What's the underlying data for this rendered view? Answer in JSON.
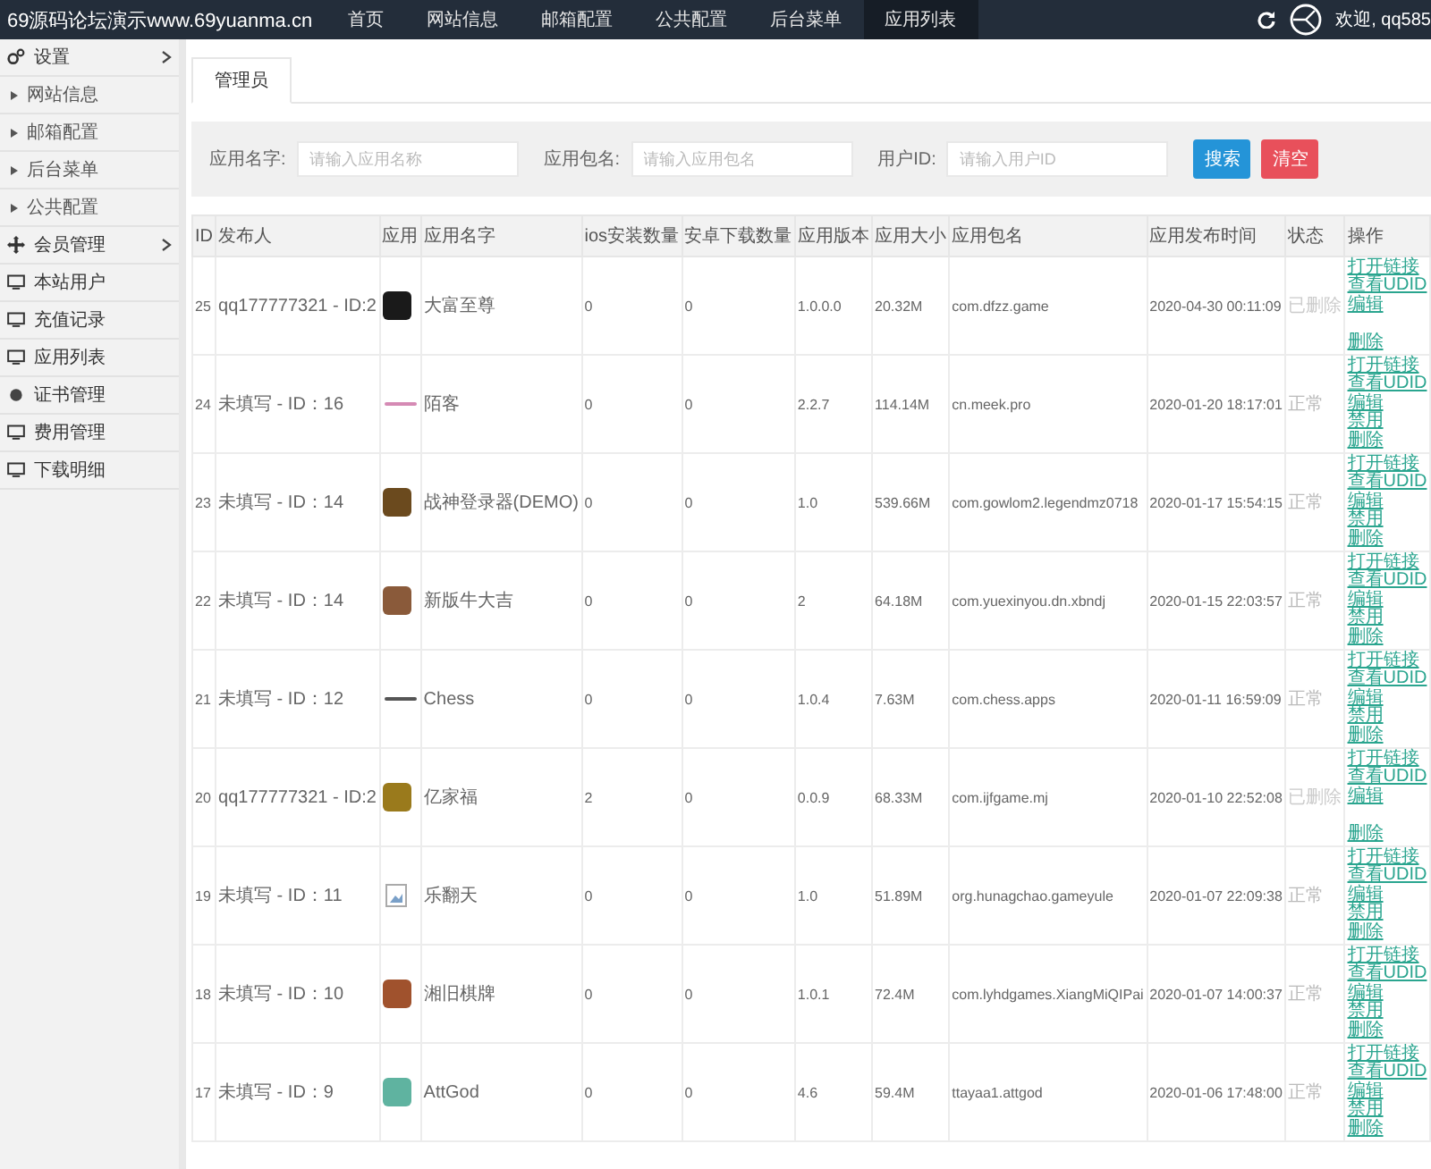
{
  "header": {
    "site_title": "69源码论坛演示www.69yuanma.cn",
    "nav": [
      {
        "label": "首页",
        "selected": false
      },
      {
        "label": "网站信息",
        "selected": false
      },
      {
        "label": "邮箱配置",
        "selected": false
      },
      {
        "label": "公共配置",
        "selected": false
      },
      {
        "label": "后台菜单",
        "selected": false
      },
      {
        "label": "应用列表",
        "selected": true
      }
    ],
    "welcome": "欢迎, qq585"
  },
  "sidebar": {
    "items": [
      {
        "label": "设置",
        "kind": "settings",
        "children": [
          {
            "label": "网站信息"
          },
          {
            "label": "邮箱配置"
          },
          {
            "label": "后台菜单"
          },
          {
            "label": "公共配置"
          }
        ]
      },
      {
        "label": "会员管理",
        "kind": "members"
      },
      {
        "label": "本站用户",
        "kind": "page"
      },
      {
        "label": "充值记录",
        "kind": "page"
      },
      {
        "label": "应用列表",
        "kind": "page"
      },
      {
        "label": "证书管理",
        "kind": "certificate"
      },
      {
        "label": "费用管理",
        "kind": "page"
      },
      {
        "label": "下载明细",
        "kind": "page"
      }
    ]
  },
  "tabs": [
    {
      "label": "管理员",
      "selected": true
    }
  ],
  "filters": {
    "fields": [
      {
        "label": "应用名字:",
        "placeholder": "请输入应用名称"
      },
      {
        "label": "应用包名:",
        "placeholder": "请输入应用包名"
      },
      {
        "label": "用户ID:",
        "placeholder": "请输入用户ID"
      }
    ],
    "buttons": [
      {
        "label": "搜索",
        "kind": "primary"
      },
      {
        "label": "清空",
        "kind": "danger"
      }
    ]
  },
  "table": {
    "columns": [
      "ID",
      "发布人",
      "应用",
      "应用名字",
      "ios安装数量",
      "安卓下载数量",
      "应用版本",
      "应用大小",
      "应用包名",
      "应用发布时间",
      "状态",
      "操作"
    ],
    "rows": [
      {
        "id": "25",
        "publisher": "qq177777321 - ID:2",
        "icon": {
          "kind": "image",
          "color": "#1a1a1a"
        },
        "name": "大富至尊",
        "ios": "0",
        "android": "0",
        "version": "1.0.0.0",
        "size": "20.32M",
        "package": "com.dfzz.game",
        "time": "2020-04-30 00:11:09",
        "status": "已删除",
        "deleted": true,
        "actions": [
          "打开链接",
          "查看UDID",
          "编辑",
          "删除"
        ]
      },
      {
        "id": "24",
        "publisher": "未填写 - ID：16",
        "icon": {
          "kind": "wordmark",
          "color": "#d58ab4"
        },
        "name": "陌客",
        "ios": "0",
        "android": "0",
        "version": "2.2.7",
        "size": "114.14M",
        "package": "cn.meek.pro",
        "time": "2020-01-20 18:17:01",
        "status": "正常",
        "deleted": false,
        "actions": [
          "打开链接",
          "查看UDID",
          "编辑",
          "禁用",
          "删除"
        ]
      },
      {
        "id": "23",
        "publisher": "未填写 - ID：14",
        "icon": {
          "kind": "image",
          "color": "#6b4a1e"
        },
        "name": "战神登录器(DEMO)",
        "ios": "0",
        "android": "0",
        "version": "1.0",
        "size": "539.66M",
        "package": "com.gowlom2.legendmz0718",
        "time": "2020-01-17 15:54:15",
        "status": "正常",
        "deleted": false,
        "actions": [
          "打开链接",
          "查看UDID",
          "编辑",
          "禁用",
          "删除"
        ]
      },
      {
        "id": "22",
        "publisher": "未填写 - ID：14",
        "icon": {
          "kind": "image",
          "color": "#8a5a3a"
        },
        "name": "新版牛大吉",
        "ios": "0",
        "android": "0",
        "version": "2",
        "size": "64.18M",
        "package": "com.yuexinyou.dn.xbndj",
        "time": "2020-01-15 22:03:57",
        "status": "正常",
        "deleted": false,
        "actions": [
          "打开链接",
          "查看UDID",
          "编辑",
          "禁用",
          "删除"
        ]
      },
      {
        "id": "21",
        "publisher": "未填写 - ID：12",
        "icon": {
          "kind": "wordmark",
          "color": "#555555"
        },
        "name": "Chess",
        "ios": "0",
        "android": "0",
        "version": "1.0.4",
        "size": "7.63M",
        "package": "com.chess.apps",
        "time": "2020-01-11 16:59:09",
        "status": "正常",
        "deleted": false,
        "actions": [
          "打开链接",
          "查看UDID",
          "编辑",
          "禁用",
          "删除"
        ]
      },
      {
        "id": "20",
        "publisher": "qq177777321 - ID:2",
        "icon": {
          "kind": "image",
          "color": "#9a7a1c"
        },
        "name": "亿家福",
        "ios": "2",
        "android": "0",
        "version": "0.0.9",
        "size": "68.33M",
        "package": "com.ijfgame.mj",
        "time": "2020-01-10 22:52:08",
        "status": "已删除",
        "deleted": true,
        "actions": [
          "打开链接",
          "查看UDID",
          "编辑",
          "删除"
        ]
      },
      {
        "id": "19",
        "publisher": "未填写 - ID：11",
        "icon": {
          "kind": "broken",
          "color": "#7aa0c8"
        },
        "name": "乐翻天",
        "ios": "0",
        "android": "0",
        "version": "1.0",
        "size": "51.89M",
        "package": "org.hunagchao.gameyule",
        "time": "2020-01-07 22:09:38",
        "status": "正常",
        "deleted": false,
        "actions": [
          "打开链接",
          "查看UDID",
          "编辑",
          "禁用",
          "删除"
        ]
      },
      {
        "id": "18",
        "publisher": "未填写 - ID：10",
        "icon": {
          "kind": "image",
          "color": "#a0522d"
        },
        "name": "湘旧棋牌",
        "ios": "0",
        "android": "0",
        "version": "1.0.1",
        "size": "72.4M",
        "package": "com.lyhdgames.XiangMiQIPai",
        "time": "2020-01-07 14:00:37",
        "status": "正常",
        "deleted": false,
        "actions": [
          "打开链接",
          "查看UDID",
          "编辑",
          "禁用",
          "删除"
        ]
      },
      {
        "id": "17",
        "publisher": "未填写 - ID：9",
        "icon": {
          "kind": "image",
          "color": "#5fb3a0"
        },
        "name": "AttGod",
        "ios": "0",
        "android": "0",
        "version": "4.6",
        "size": "59.4M",
        "package": "ttayaa1.attgod",
        "time": "2020-01-06 17:48:00",
        "status": "正常",
        "deleted": false,
        "actions": [
          "打开链接",
          "查看UDID",
          "编辑",
          "禁用",
          "删除"
        ]
      }
    ]
  }
}
